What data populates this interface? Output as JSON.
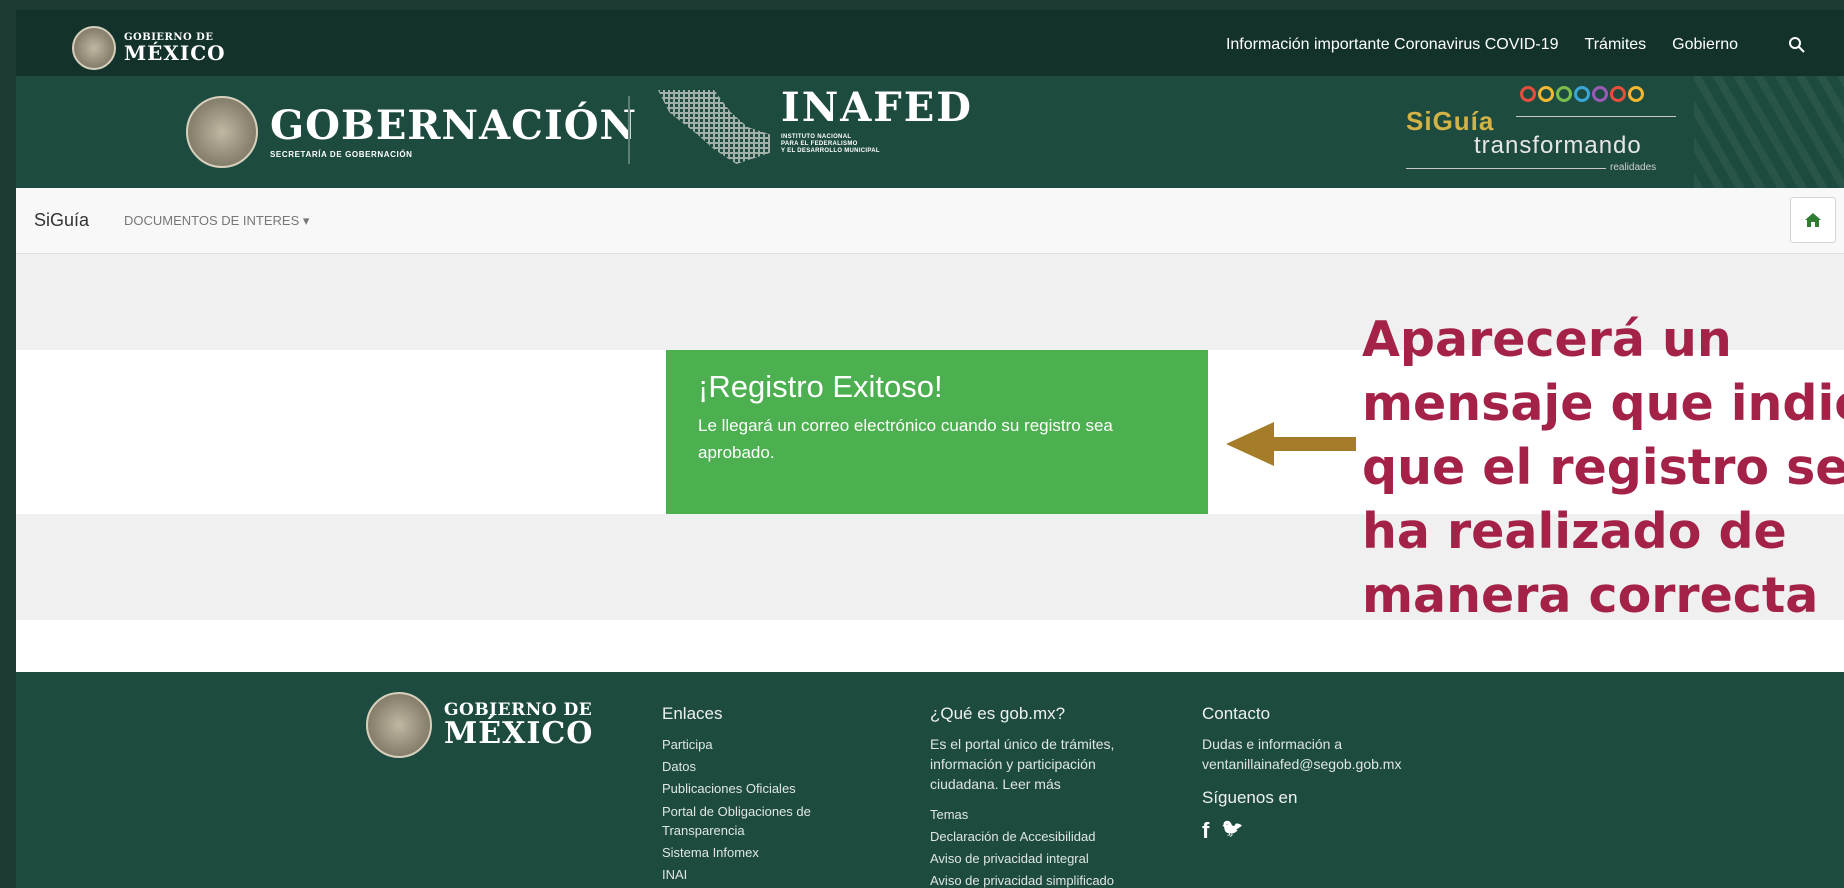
{
  "topbar": {
    "logo_small": "GOBIERNO DE",
    "logo_big": "MÉXICO",
    "nav": [
      "Información importante Coronavirus COVID-19",
      "Trámites",
      "Gobierno"
    ]
  },
  "banner": {
    "gob_title": "GOBERNACIÓN",
    "gob_sub": "SECRETARÍA DE GOBERNACIÓN",
    "inafed_title": "INAFED",
    "inafed_sub": [
      "INSTITUTO NACIONAL",
      "PARA EL FEDERALISMO",
      "Y EL DESARROLLO MUNICIPAL"
    ],
    "siguia": "SiGuía",
    "transformando": "transformando",
    "realidades": "realidades",
    "dot_colors": [
      "#e94e3c",
      "#f2b630",
      "#7bbf4b",
      "#3aa6d8",
      "#9b59b6",
      "#e94e3c",
      "#f2b630"
    ]
  },
  "navbar": {
    "brand": "SiGuía",
    "menu": "DOCUMENTOS DE INTERES",
    "menu_caret": "▾",
    "home_icon": "⌂"
  },
  "alert": {
    "title": "¡Registro Exitoso!",
    "body": "Le llegará un correo electrónico cuando su registro sea aprobado.",
    "color": "#4caf50"
  },
  "annotation": {
    "lines": [
      "Aparecerá un",
      "mensaje que indica",
      "que el registro se",
      "ha realizado de",
      "manera correcta"
    ],
    "color": "#a42148",
    "arrow_color": "#a57c2a"
  },
  "footer": {
    "logo_small": "GOBIERNO DE",
    "logo_big": "MÉXICO",
    "enlaces": {
      "title": "Enlaces",
      "items": [
        "Participa",
        "Datos",
        "Publicaciones Oficiales",
        "Portal de Obligaciones de Transparencia",
        "Sistema Infomex",
        "INAI"
      ]
    },
    "que_es": {
      "title": "¿Qué es gob.mx?",
      "text": "Es el portal único de trámites, información y participación ciudadana. Leer más",
      "items": [
        "Temas",
        "Declaración de Accesibilidad",
        "Aviso de privacidad integral",
        "Aviso de privacidad simplificado"
      ]
    },
    "contacto": {
      "title": "Contacto",
      "text": "Dudas e información a ventanillainafed@segob.gob.mx",
      "follow": "Síguenos en",
      "facebook": "f",
      "twitter": "🐦"
    }
  }
}
